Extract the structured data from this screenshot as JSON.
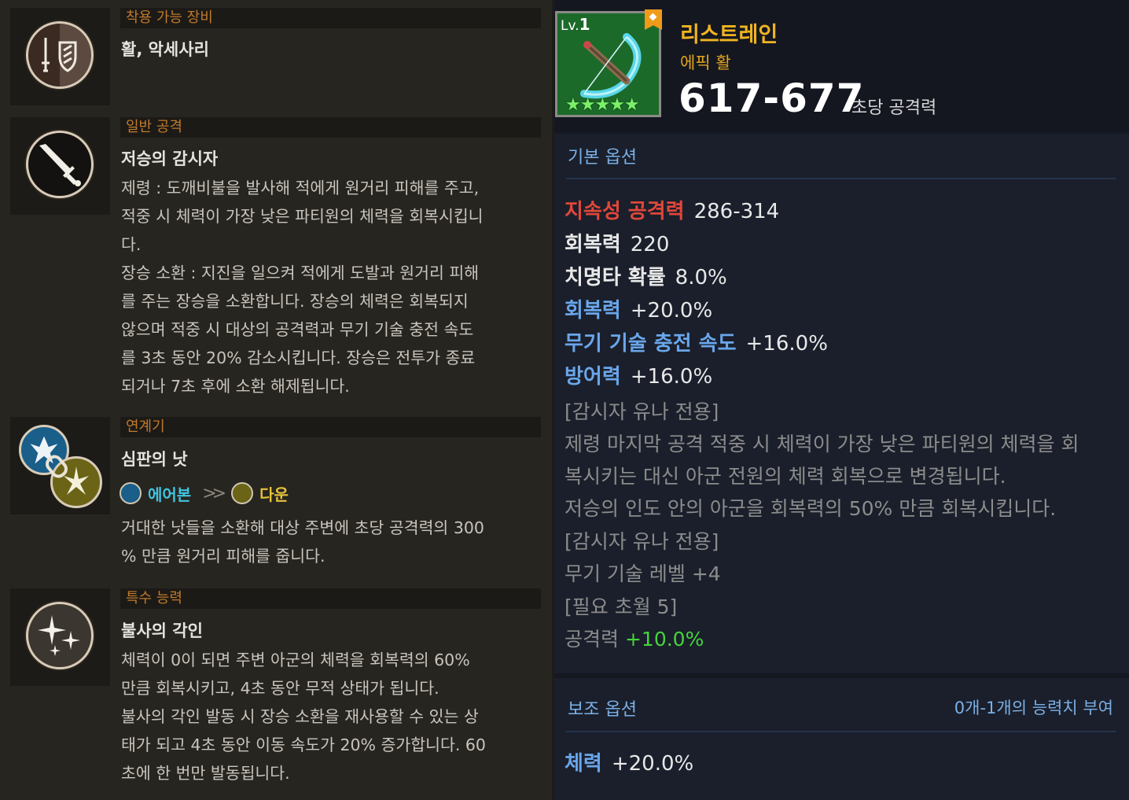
{
  "left": {
    "sections": [
      {
        "header": "착용 가능 장비",
        "title": "활, 악세사리",
        "icon": "sword-shield-icon",
        "desc": []
      },
      {
        "header": "일반 공격",
        "title": "저승의 감시자",
        "icon": "sword-icon",
        "desc": [
          "제령 : 도깨비불을 발사해 적에게 원거리 피해를 주고,",
          "적중 시 체력이 가장 낮은 파티원의 체력을 회복시킵니",
          "다.",
          "장승 소환 : 지진을 일으켜 적에게 도발과 원거리 피해",
          "를 주는 장승을 소환합니다. 장승의 체력은 회복되지",
          "않으며 적중 시 대상의 공격력과 무기 기술 충전 속도",
          "를 3초 동안 20% 감소시킵니다. 장승은 전투가 종료",
          "되거나 7초 후에 소환 해제됩니다."
        ]
      },
      {
        "header": "연계기",
        "title": "심판의 낫",
        "icon": "chain-skill-icon",
        "chain": {
          "from": "에어본",
          "to": "다운"
        },
        "desc": [
          "거대한 낫들을 소환해 대상 주변에 초당 공격력의 300",
          "% 만큼 원거리 피해를 줍니다."
        ]
      },
      {
        "header": "특수 능력",
        "title": "불사의 각인",
        "icon": "sparkle-icon",
        "desc": [
          "체력이 0이 되면 주변 아군의 체력을 회복력의 60%",
          "만큼 회복시키고, 4초 동안 무적 상태가 됩니다.",
          "불사의 각인 발동 시 장승 소환을 재사용할 수 있는 상",
          "태가 되고 4초 동안 이동 속도가 20% 증가합니다. 60",
          "초에 한 번만 발동됩니다."
        ]
      }
    ]
  },
  "item": {
    "level_prefix": "Lv.",
    "level": "1",
    "stars": "★★★★★",
    "name": "리스트레인",
    "type": "에픽 활",
    "attack": "617-677",
    "attack_label": "초당 공격력",
    "icon": "bow-icon"
  },
  "basic_options": {
    "title": "기본 옵션",
    "stats": [
      {
        "key": "지속성 공격력",
        "value": "286-314",
        "color": "#e0473a"
      },
      {
        "key": "회복력",
        "value": "220",
        "color": "#e8e8e8"
      },
      {
        "key": "치명타 확률",
        "value": "8.0%",
        "color": "#e8e8e8"
      },
      {
        "key": "회복력",
        "value": "+20.0%",
        "color": "#6aa6ea"
      },
      {
        "key": "무기 기술 충전 속도",
        "value": "+16.0%",
        "color": "#6aa6ea"
      },
      {
        "key": "방어력",
        "value": "+16.0%",
        "color": "#6aa6ea"
      }
    ],
    "notes": [
      "[감시자 유나 전용]",
      "제령 마지막 공격 적중 시 체력이 가장 낮은 파티원의 체력을 회",
      "복시키는 대신 아군 전원의 체력 회복으로 변경됩니다.",
      "저승의 인도 안의 아군을 회복력의 50% 만큼 회복시킵니다.",
      "[감시자 유나 전용]",
      "무기 기술 레벨 +4",
      "[필요 초월 5]"
    ],
    "final": {
      "key": "공격력",
      "value": "+10.0%",
      "color": "#45d43b"
    }
  },
  "sub_options": {
    "title": "보조 옵션",
    "right_text": "0개-1개의 능력치 부여",
    "stats": [
      {
        "key": "체력",
        "value": "+20.0%",
        "color": "#6aa6ea"
      }
    ]
  }
}
